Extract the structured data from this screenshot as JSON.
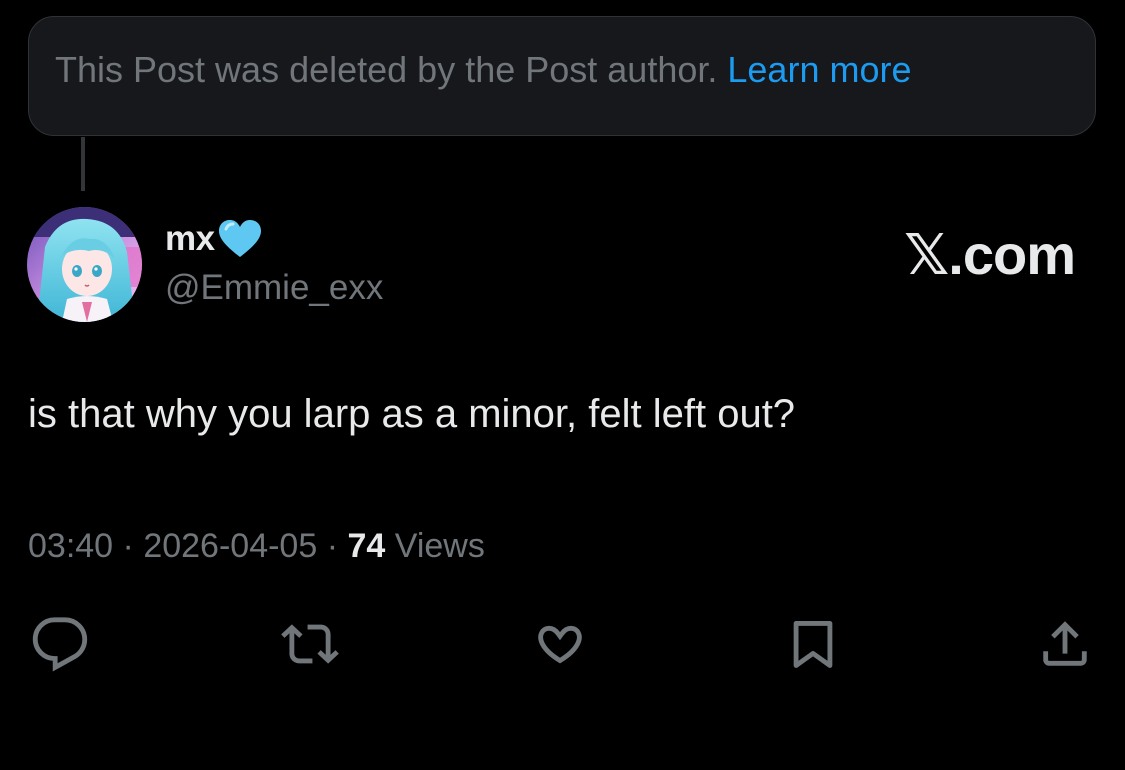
{
  "deleted_notice": {
    "text": "This Post was deleted by the Post author.",
    "link_label": "Learn more"
  },
  "author": {
    "display_name": "mx",
    "handle": "@Emmie_exx",
    "badge_icon": "light-blue-heart-emoji"
  },
  "brand": "𝕏.com",
  "post": {
    "text": "is that why you larp as a minor, felt left out?"
  },
  "meta": {
    "time": "03:40",
    "separator": "·",
    "date": "2026-04-05",
    "views_count": "74",
    "views_label": "Views"
  },
  "actions": [
    {
      "icon": "reply-icon"
    },
    {
      "icon": "repost-icon"
    },
    {
      "icon": "like-icon"
    },
    {
      "icon": "bookmark-icon"
    },
    {
      "icon": "share-icon"
    }
  ],
  "colors": {
    "background": "#000000",
    "text_primary": "#e7e9ea",
    "text_secondary": "#71767b",
    "link": "#1d9bf0",
    "heart": "#5ec8f2"
  }
}
